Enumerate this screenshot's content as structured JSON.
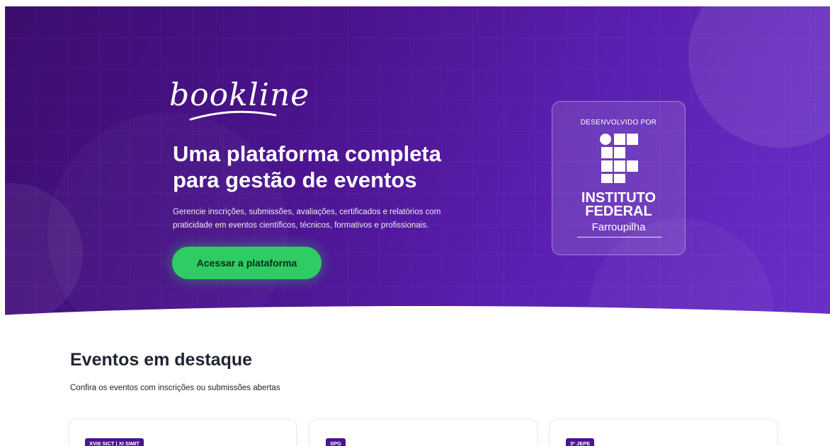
{
  "hero": {
    "logo_text": "bookline",
    "title_line1": "Uma plataforma completa",
    "title_line2": "para gestão de eventos",
    "description_line1": "Gerencie inscrições, submissões, avaliações, certificados e relatórios com",
    "description_line2": "praticidade em eventos científicos, técnicos, formativos e profissionais.",
    "cta_label": "Acessar a plataforma"
  },
  "badge": {
    "label": "DESENVOLVIDO POR",
    "institution_line1": "INSTITUTO",
    "institution_line2": "FEDERAL",
    "campus": "Farroupilha",
    "icon": "instituto-federal-logo-icon"
  },
  "events": {
    "title": "Eventos em destaque",
    "subtitle": "Confira os eventos com inscrições ou submissões abertas",
    "cards": [
      {
        "tag": "XVIII SICT | XI SIMIT"
      },
      {
        "tag": "SPG"
      },
      {
        "tag": "3ª JEPE"
      }
    ]
  },
  "colors": {
    "hero_primary": "#4a138c",
    "cta": "#2ecc63",
    "tag": "#4b1494"
  }
}
